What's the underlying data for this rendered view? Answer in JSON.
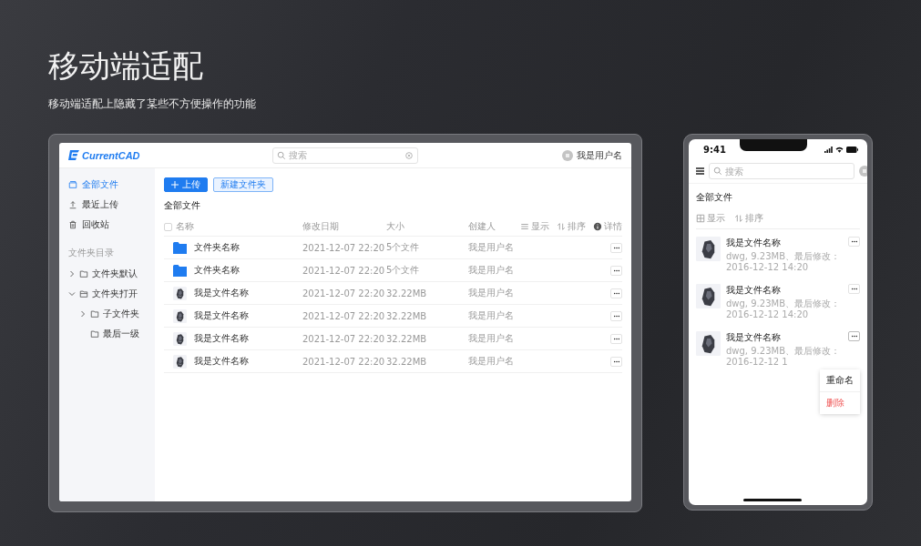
{
  "title": "移动端适配",
  "subtitle": "移动端适配上隐藏了某些不方便操作的功能",
  "desktop": {
    "logo": "CurrentCAD",
    "search": {
      "placeholder": "搜索"
    },
    "user": "我是用户名",
    "sidebar": {
      "items": [
        {
          "label": "全部文件",
          "selected": true
        },
        {
          "label": "最近上传",
          "selected": false
        },
        {
          "label": "回收站",
          "selected": false
        }
      ],
      "tree_title": "文件夹目录",
      "tree": [
        {
          "label": "文件夹默认",
          "expanded": false
        },
        {
          "label": "文件夹打开",
          "expanded": true,
          "children": [
            {
              "label": "子文件夹",
              "expanded": false
            },
            {
              "label": "最后一级"
            }
          ]
        }
      ]
    },
    "buttons": [
      {
        "label": "上传",
        "kind": "primary"
      },
      {
        "label": "新建文件夹",
        "kind": "secondary"
      }
    ],
    "breadcrumb": "全部文件",
    "table": {
      "select_all": {
        "checked": false
      },
      "columns": [
        "名称",
        "修改日期",
        "大小",
        "创建人"
      ],
      "tools": [
        {
          "label": "显示"
        },
        {
          "label": "排序"
        },
        {
          "label": "详情"
        }
      ],
      "rows": [
        {
          "kind": "folder",
          "name": "文件夹名称",
          "date": "2021-12-07 22:20",
          "size": "5个文件",
          "creator": "我是用户名"
        },
        {
          "kind": "folder",
          "name": "文件夹名称",
          "date": "2021-12-07 22:20",
          "size": "5个文件",
          "creator": "我是用户名"
        },
        {
          "kind": "file",
          "name": "我是文件名称",
          "date": "2021-12-07 22:20",
          "size": "32.22MB",
          "creator": "我是用户名"
        },
        {
          "kind": "file",
          "name": "我是文件名称",
          "date": "2021-12-07 22:20",
          "size": "32.22MB",
          "creator": "我是用户名"
        },
        {
          "kind": "file",
          "name": "我是文件名称",
          "date": "2021-12-07 22:20",
          "size": "32.22MB",
          "creator": "我是用户名"
        },
        {
          "kind": "file",
          "name": "我是文件名称",
          "date": "2021-12-07 22:20",
          "size": "32.22MB",
          "creator": "我是用户名"
        }
      ]
    }
  },
  "mobile": {
    "time": "9:41",
    "search": {
      "placeholder": "搜索"
    },
    "breadcrumb": "全部文件",
    "tools": [
      {
        "label": "显示"
      },
      {
        "label": "排序"
      }
    ],
    "files": [
      {
        "name": "我是文件名称",
        "meta": "dwg, 9.23MB、最后修改：2016-12-12 14:20",
        "menu_open": false
      },
      {
        "name": "我是文件名称",
        "meta": "dwg, 9.23MB、最后修改：2016-12-12 14:20",
        "menu_open": false
      },
      {
        "name": "我是文件名称",
        "meta": "dwg, 9.23MB、最后修改：2016-12-12 1",
        "menu_open": true
      }
    ],
    "menu": [
      {
        "label": "重命名",
        "kind": "normal"
      },
      {
        "label": "删除",
        "kind": "danger"
      }
    ]
  }
}
